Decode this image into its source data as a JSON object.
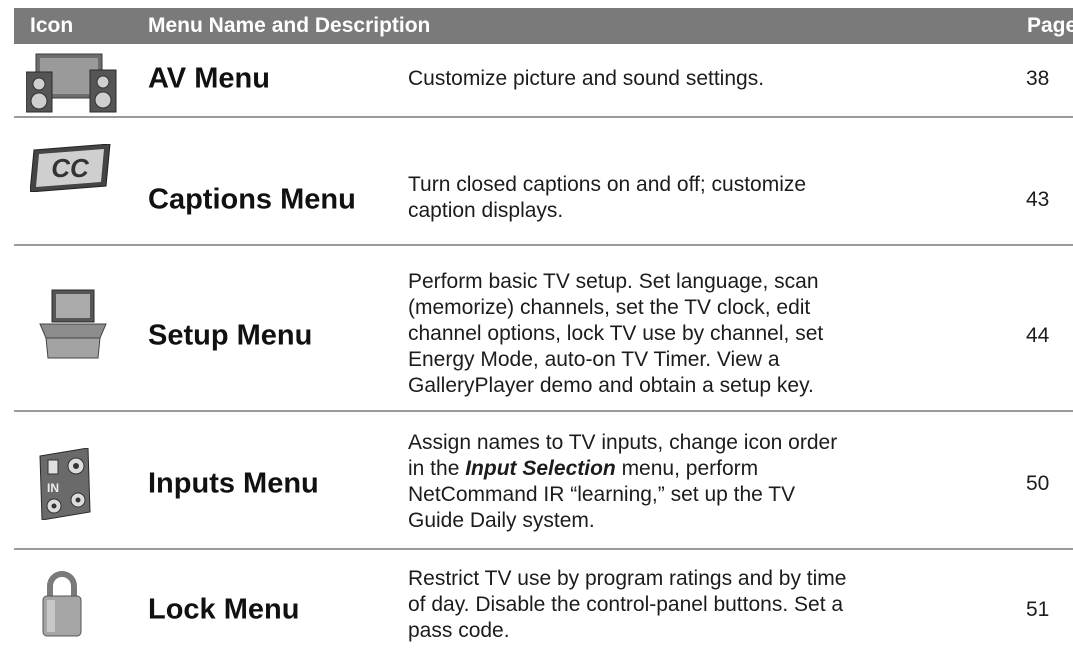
{
  "header": {
    "col_icon": "Icon",
    "col_name": "Menu Name and Description",
    "col_page": "Page"
  },
  "rows": [
    {
      "icon": "av-speakers-icon",
      "name": "AV Menu",
      "desc": "Customize picture and sound settings.",
      "page": "38"
    },
    {
      "icon": "cc-captions-icon",
      "name": "Captions Menu",
      "desc": "Turn closed captions on and off; customize caption displays.",
      "page": "43"
    },
    {
      "icon": "setup-tv-box-icon",
      "name": "Setup Menu",
      "desc": "Perform basic TV setup.  Set language, scan (memorize) channels, set the TV clock, edit channel options, lock TV use by channel, set Energy Mode, auto-on TV Timer.  View a GalleryPlayer demo and obtain a setup key.",
      "page": "44"
    },
    {
      "icon": "inputs-jacks-icon",
      "name": "Inputs Menu",
      "desc_pre": "Assign names to TV inputs, change icon order in the ",
      "desc_em": "Input Selection",
      "desc_post": " menu, perform NetCommand IR “learning,” set up the TV Guide Daily system.",
      "page": "50"
    },
    {
      "icon": "padlock-icon",
      "name": "Lock Menu",
      "desc": "Restrict TV use by program ratings and by time of day.  Disable the control-panel buttons.  Set a pass code.",
      "page": "51"
    }
  ]
}
